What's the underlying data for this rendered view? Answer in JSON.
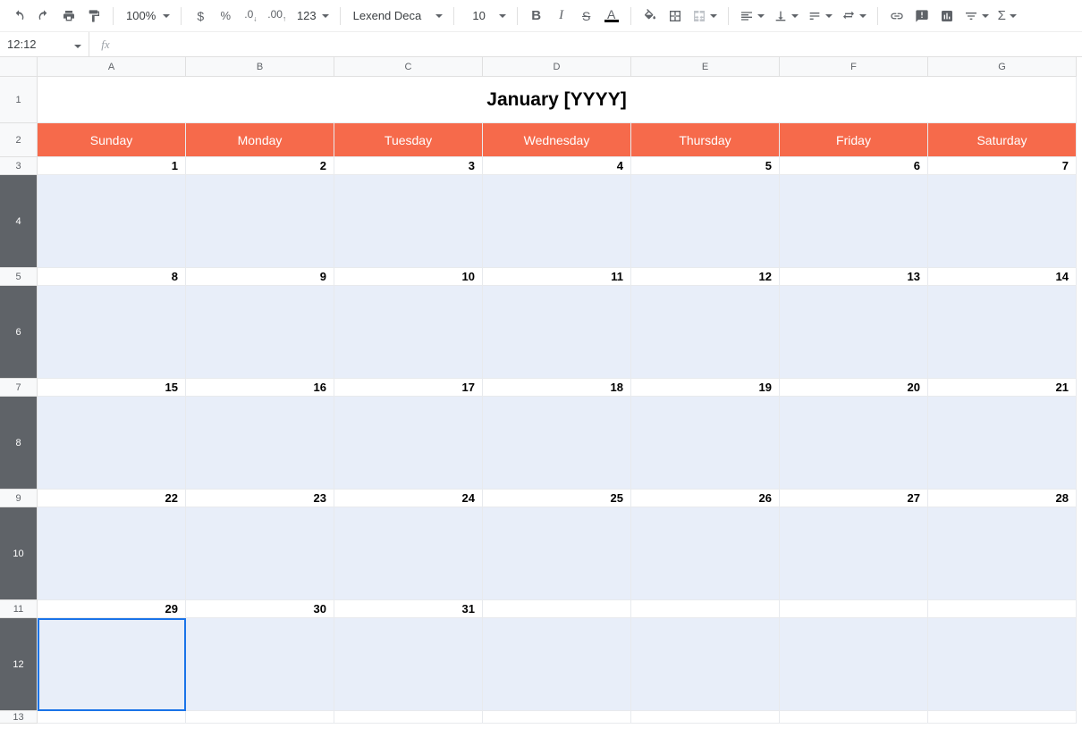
{
  "toolbar": {
    "zoom": "100%",
    "font_name": "Lexend Deca",
    "font_size": "10",
    "number_fmt_label": "123"
  },
  "namebox": {
    "value": "12:12"
  },
  "formula_bar": {
    "fx_label": "fx",
    "value": ""
  },
  "columns": [
    "A",
    "B",
    "C",
    "D",
    "E",
    "F",
    "G"
  ],
  "rows": [
    "1",
    "2",
    "3",
    "4",
    "5",
    "6",
    "7",
    "8",
    "9",
    "10",
    "11",
    "12",
    "13"
  ],
  "selected_rows": [
    "4",
    "6",
    "8",
    "10",
    "12"
  ],
  "calendar": {
    "title": "January [YYYY]",
    "day_headers": [
      "Sunday",
      "Monday",
      "Tuesday",
      "Wednesday",
      "Thursday",
      "Friday",
      "Saturday"
    ],
    "weeks": [
      [
        "1",
        "2",
        "3",
        "4",
        "5",
        "6",
        "7"
      ],
      [
        "8",
        "9",
        "10",
        "11",
        "12",
        "13",
        "14"
      ],
      [
        "15",
        "16",
        "17",
        "18",
        "19",
        "20",
        "21"
      ],
      [
        "22",
        "23",
        "24",
        "25",
        "26",
        "27",
        "28"
      ],
      [
        "29",
        "30",
        "31",
        "",
        "",
        "",
        ""
      ]
    ]
  },
  "colors": {
    "accent": "#f66a4b",
    "selection": "#1a73e8",
    "body_fill": "#e8eef9"
  }
}
